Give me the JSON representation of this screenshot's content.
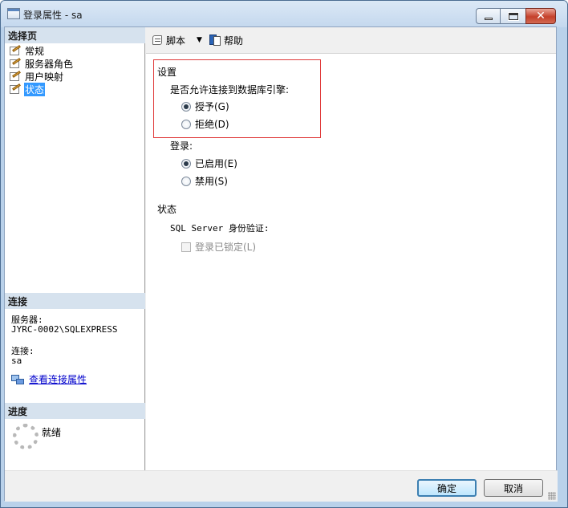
{
  "window": {
    "title": "登录属性 - sa"
  },
  "left": {
    "select_page_header": "选择页",
    "pages": [
      {
        "label": "常规",
        "selected": false
      },
      {
        "label": "服务器角色",
        "selected": false
      },
      {
        "label": "用户映射",
        "selected": false
      },
      {
        "label": "状态",
        "selected": true
      }
    ],
    "connection_header": "连接",
    "server_label": "服务器:",
    "server_value": "JYRC-0002\\SQLEXPRESS",
    "connection_label": "连接:",
    "connection_value": "sa",
    "view_conn_props": "查看连接属性",
    "progress_header": "进度",
    "progress_status": "就绪"
  },
  "toolbar": {
    "script_label": "脚本",
    "help_label": "帮助"
  },
  "content": {
    "settings_title": "设置",
    "connect_question": "是否允许连接到数据库引擎:",
    "grant_label": "授予(G)",
    "deny_label": "拒绝(D)",
    "login_title": "登录:",
    "enabled_label": "已启用(E)",
    "disabled_label": "禁用(S)",
    "status_title": "状态",
    "auth_label": "SQL Server 身份验证:",
    "locked_label": "登录已锁定(L)",
    "connect_permission": "grant",
    "login_state": "enabled",
    "login_locked": false
  },
  "buttons": {
    "ok_label": "确定",
    "cancel_label": "取消"
  }
}
